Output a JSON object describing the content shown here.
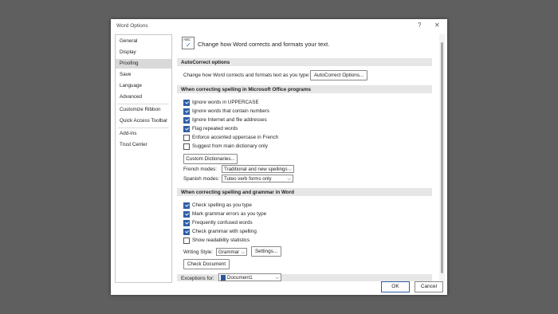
{
  "window": {
    "title": "Word Options",
    "help": "?",
    "close": "✕"
  },
  "sidebar": {
    "items": [
      {
        "label": "General"
      },
      {
        "label": "Display"
      },
      {
        "label": "Proofing"
      },
      {
        "label": "Save"
      },
      {
        "label": "Language"
      },
      {
        "label": "Advanced"
      },
      {
        "label": "Customize Ribbon"
      },
      {
        "label": "Quick Access Toolbar"
      },
      {
        "label": "Add-ins"
      },
      {
        "label": "Trust Center"
      }
    ],
    "active": "Proofing"
  },
  "header": {
    "icon_text": "ABC",
    "text": "Change how Word corrects and formats your text."
  },
  "autocorrect": {
    "section": "AutoCorrect options",
    "description": "Change how Word corrects and formats text as you type:",
    "button": "AutoCorrect Options..."
  },
  "office_spelling": {
    "section": "When correcting spelling in Microsoft Office programs",
    "options": [
      {
        "label": "Ignore words in UPPERCASE",
        "checked": true
      },
      {
        "label": "Ignore words that contain numbers",
        "checked": true
      },
      {
        "label": "Ignore Internet and file addresses",
        "checked": true
      },
      {
        "label": "Flag repeated words",
        "checked": true
      },
      {
        "label": "Enforce accented uppercase in French",
        "checked": false
      },
      {
        "label": "Suggest from main dictionary only",
        "checked": false
      }
    ],
    "custom_dict_button": "Custom Dictionaries...",
    "french_label": "French modes:",
    "french_value": "Traditional and new spellings",
    "spanish_label": "Spanish modes:",
    "spanish_value": "Tuteo verb forms only"
  },
  "word_grammar": {
    "section": "When correcting spelling and grammar in Word",
    "options": [
      {
        "label": "Check spelling as you type",
        "checked": true
      },
      {
        "label": "Mark grammar errors as you type",
        "checked": true
      },
      {
        "label": "Frequently confused words",
        "checked": true
      },
      {
        "label": "Check grammar with spelling",
        "checked": true
      },
      {
        "label": "Show readability statistics",
        "checked": false
      }
    ],
    "writing_style_label": "Writing Style:",
    "writing_style_value": "Grammar",
    "settings_button": "Settings...",
    "check_document_button": "Check Document"
  },
  "exceptions": {
    "label": "Exceptions for:",
    "value": "Document1"
  },
  "footer": {
    "ok": "OK",
    "cancel": "Cancel"
  }
}
